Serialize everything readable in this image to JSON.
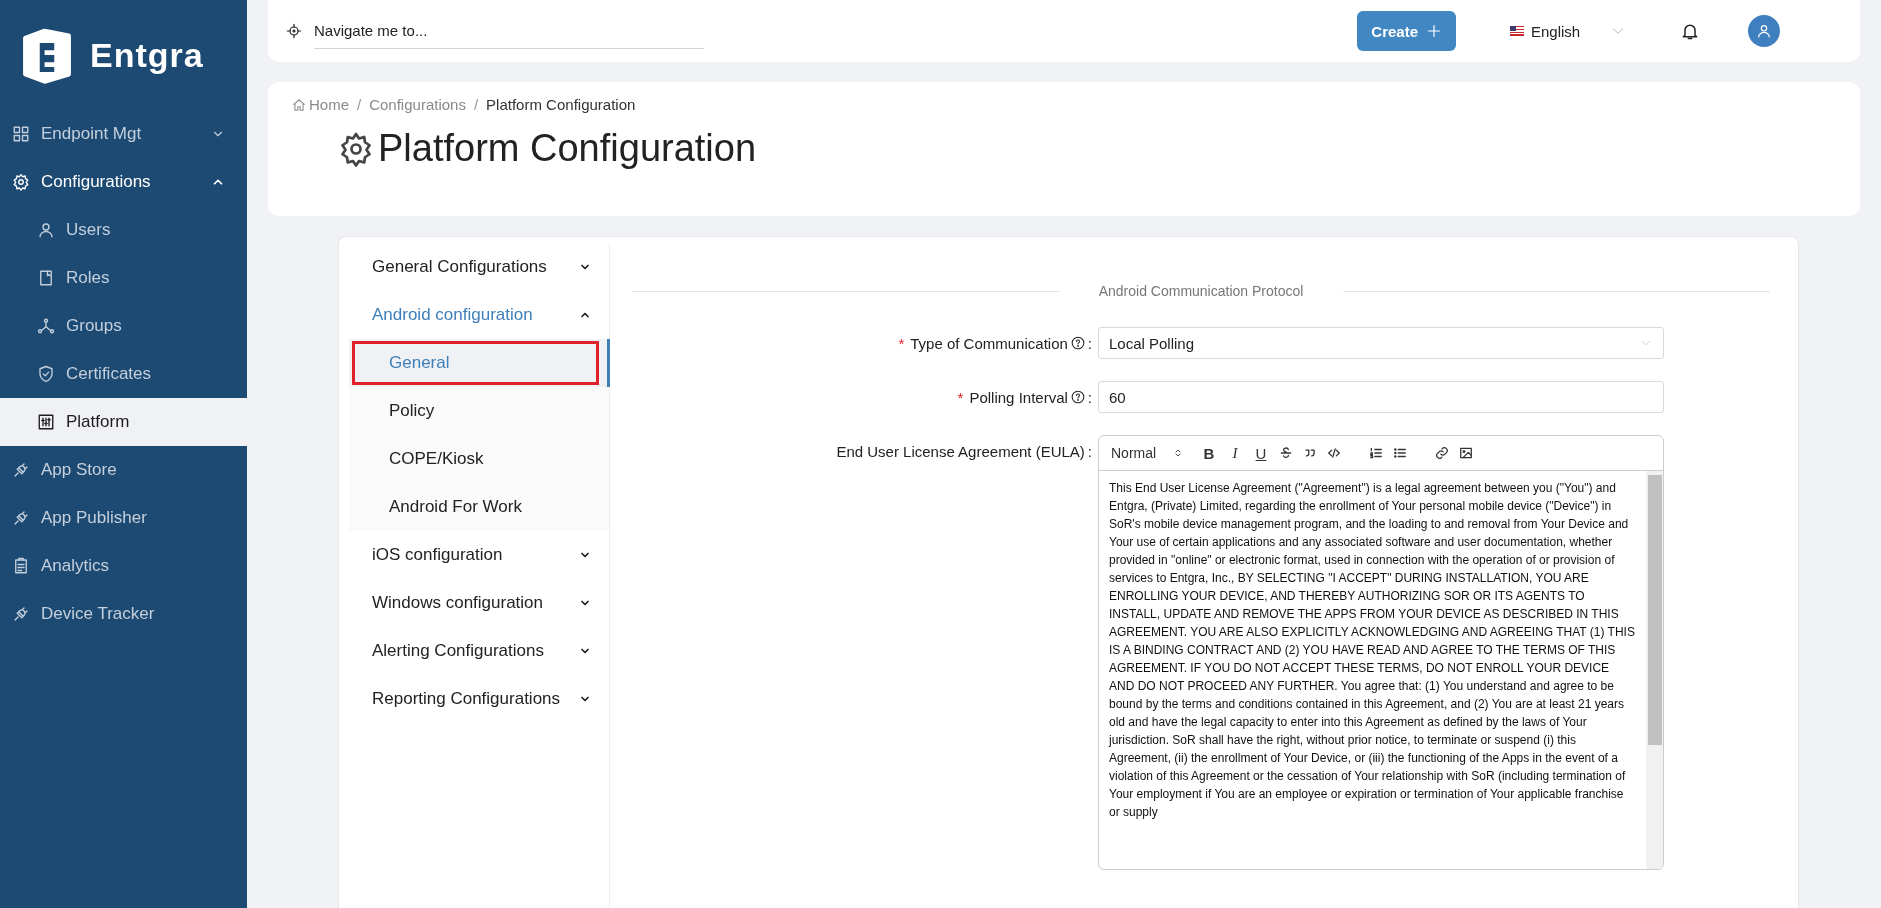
{
  "brand": {
    "name": "Entgra"
  },
  "sidebar": {
    "items": [
      {
        "label": "Endpoint Mgt",
        "selected": false,
        "expanded": false
      },
      {
        "label": "Configurations",
        "selected": true,
        "expanded": true,
        "children": [
          {
            "label": "Users",
            "selected": false
          },
          {
            "label": "Roles",
            "selected": false
          },
          {
            "label": "Groups",
            "selected": false
          },
          {
            "label": "Certificates",
            "selected": false
          },
          {
            "label": "Platform",
            "selected": true
          }
        ]
      },
      {
        "label": "App Store",
        "selected": false
      },
      {
        "label": "App Publisher",
        "selected": false
      },
      {
        "label": "Analytics",
        "selected": false
      },
      {
        "label": "Device Tracker",
        "selected": false
      }
    ]
  },
  "topbar": {
    "search": {
      "placeholder": "Navigate me to..."
    },
    "create_button": "Create",
    "language": "English"
  },
  "header": {
    "breadcrumb_separator": "/",
    "breadcrumb": [
      "Home",
      "Configurations",
      "Platform Configuration"
    ],
    "title": "Platform Configuration"
  },
  "config_menu": {
    "items": [
      {
        "label": "General Configurations",
        "expanded": false
      },
      {
        "label": "Android configuration",
        "expanded": true,
        "children": [
          {
            "label": "General",
            "selected": true
          },
          {
            "label": "Policy",
            "selected": false
          },
          {
            "label": "COPE/Kiosk",
            "selected": false
          },
          {
            "label": "Android For Work",
            "selected": false
          }
        ]
      },
      {
        "label": "iOS configuration",
        "expanded": false
      },
      {
        "label": "Windows configuration",
        "expanded": false
      },
      {
        "label": "Alerting Configurations",
        "expanded": false
      },
      {
        "label": "Reporting Configurations",
        "expanded": false
      }
    ]
  },
  "form": {
    "section_title": "Android Communication Protocol",
    "separator": ":",
    "required_mark": "*",
    "fields": [
      {
        "kind": "select",
        "label": "Type of Communication",
        "required": true,
        "help": true,
        "value": "Local Polling"
      },
      {
        "kind": "input",
        "label": "Polling Interval",
        "required": true,
        "help": true,
        "value": "60"
      },
      {
        "kind": "editor",
        "label": "End User License Agreement (EULA)",
        "required": false,
        "help": false,
        "toolbar": {
          "format": "Normal",
          "marks": [
            "B",
            "I",
            "U"
          ]
        },
        "content": "This End User License Agreement (\"Agreement\") is a legal agreement between you (\"You\") and Entgra, (Private) Limited, regarding the enrollment of Your personal mobile device (\"Device\") in SoR's mobile device management program, and the loading to and removal from Your Device and Your use of certain applications and any associated software and user documentation, whether provided in \"online\" or electronic format, used in connection with the operation of or provision of services to Entgra, Inc., BY SELECTING \"I ACCEPT\" DURING INSTALLATION, YOU ARE ENROLLING YOUR DEVICE, AND THEREBY AUTHORIZING SOR OR ITS AGENTS TO INSTALL, UPDATE AND REMOVE THE APPS FROM YOUR DEVICE AS DESCRIBED IN THIS AGREEMENT. YOU ARE ALSO EXPLICITLY ACKNOWLEDGING AND AGREEING THAT (1) THIS IS A BINDING CONTRACT AND (2) YOU HAVE READ AND AGREE TO THE TERMS OF THIS AGREEMENT. IF YOU DO NOT ACCEPT THESE TERMS, DO NOT ENROLL YOUR DEVICE AND DO NOT PROCEED ANY FURTHER. You agree that: (1) You understand and agree to be bound by the terms and conditions contained in this Agreement, and (2) You are at least 21 years old and have the legal capacity to enter into this Agreement as defined by the laws of Your jurisdiction. SoR shall have the right, without prior notice, to terminate or suspend (i) this Agreement, (ii) the enrollment of Your Device, or (iii) the functioning of the Apps in the event of a violation of this Agreement or the cessation of Your relationship with SoR (including termination of Your employment if You are an employee or expiration or termination of Your applicable franchise or supply"
      }
    ]
  }
}
